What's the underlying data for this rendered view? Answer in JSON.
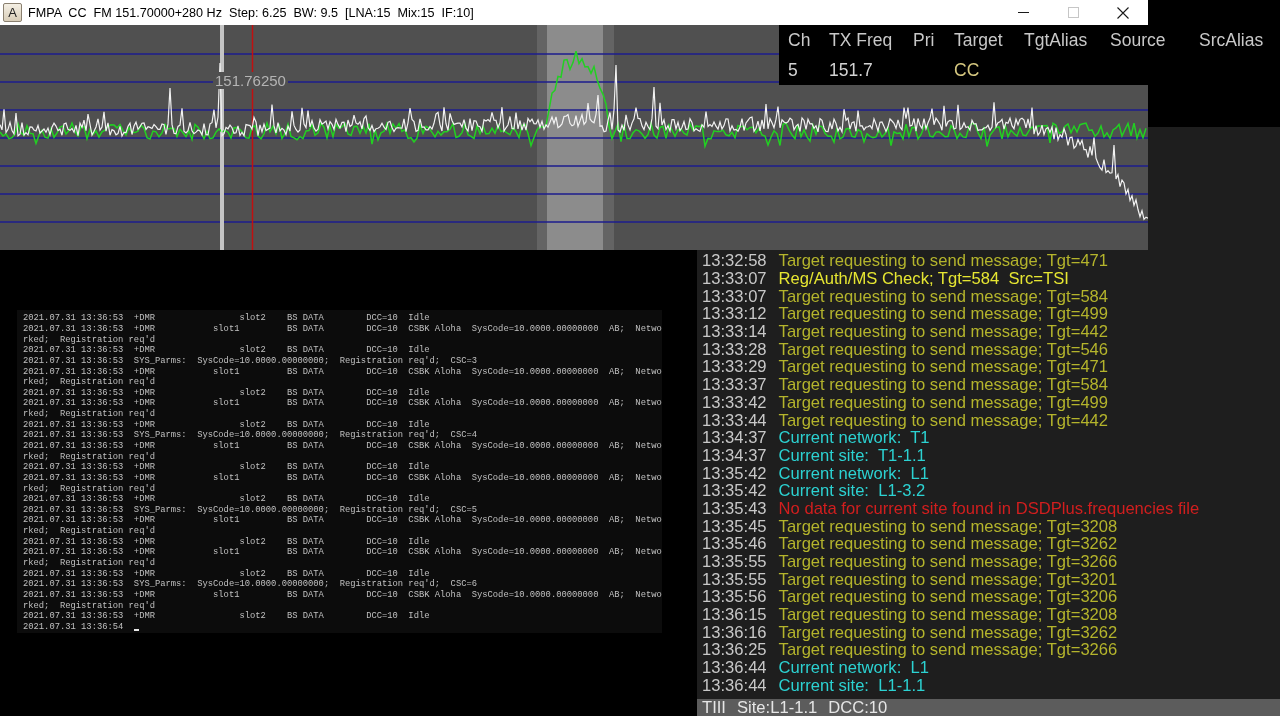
{
  "spectrum_window": {
    "app_icon": "A",
    "title": "FMPA  CC  FM 151.70000+280 Hz  Step: 6.25  BW: 9.5  [LNA:15  Mix:15  IF:10]",
    "window_controls": [
      {
        "kind": "minimize",
        "disabled": false
      },
      {
        "kind": "maximize",
        "disabled": true
      },
      {
        "kind": "close",
        "disabled": false
      }
    ],
    "frequency_label": "151.76250"
  },
  "channel_table": {
    "columns": [
      "Ch",
      "TX Freq",
      "Pri",
      "Target",
      "TgtAlias",
      "Source",
      "SrcAlias"
    ],
    "rows": [
      {
        "ch": "5",
        "tx_freq": "151.7",
        "target": "CC"
      }
    ]
  },
  "console": {
    "lines": [
      "2021.07.31 13:36:53  +DMR                slot2    BS DATA        DCC=10  Idle",
      "2021.07.31 13:36:53  +DMR           slot1         BS DATA        DCC=10  CSBK Aloha  SysCode=10.0000.00000000  AB;  Netwo",
      "rked;  Registration req'd",
      "2021.07.31 13:36:53  +DMR                slot2    BS DATA        DCC=10  Idle",
      "2021.07.31 13:36:53  SYS_Parms:  SysCode=10.0000.00000000;  Registration req'd;  CSC=3",
      "2021.07.31 13:36:53  +DMR           slot1         BS DATA        DCC=10  CSBK Aloha  SysCode=10.0000.00000000  AB;  Netwo",
      "rked;  Registration req'd",
      "2021.07.31 13:36:53  +DMR                slot2    BS DATA        DCC=10  Idle",
      "2021.07.31 13:36:53  +DMR           slot1         BS DATA        DCC=10  CSBK Aloha  SysCode=10.0000.00000000  AB;  Netwo",
      "rked;  Registration req'd",
      "2021.07.31 13:36:53  +DMR                slot2    BS DATA        DCC=10  Idle",
      "2021.07.31 13:36:53  SYS_Parms:  SysCode=10.0000.00000000;  Registration req'd;  CSC=4",
      "2021.07.31 13:36:53  +DMR           slot1         BS DATA        DCC=10  CSBK Aloha  SysCode=10.0000.00000000  AB;  Netwo",
      "rked;  Registration req'd",
      "2021.07.31 13:36:53  +DMR                slot2    BS DATA        DCC=10  Idle",
      "2021.07.31 13:36:53  +DMR           slot1         BS DATA        DCC=10  CSBK Aloha  SysCode=10.0000.00000000  AB;  Netwo",
      "rked;  Registration req'd",
      "2021.07.31 13:36:53  +DMR                slot2    BS DATA        DCC=10  Idle",
      "2021.07.31 13:36:53  SYS_Parms:  SysCode=10.0000.00000000;  Registration req'd;  CSC=5",
      "2021.07.31 13:36:53  +DMR           slot1         BS DATA        DCC=10  CSBK Aloha  SysCode=10.0000.00000000  AB;  Netwo",
      "rked;  Registration req'd",
      "2021.07.31 13:36:53  +DMR                slot2    BS DATA        DCC=10  Idle",
      "2021.07.31 13:36:53  +DMR           slot1         BS DATA        DCC=10  CSBK Aloha  SysCode=10.0000.00000000  AB;  Netwo",
      "rked;  Registration req'd",
      "2021.07.31 13:36:53  +DMR                slot2    BS DATA        DCC=10  Idle",
      "2021.07.31 13:36:53  SYS_Parms:  SysCode=10.0000.00000000;  Registration req'd;  CSC=6",
      "2021.07.31 13:36:53  +DMR           slot1         BS DATA        DCC=10  CSBK Aloha  SysCode=10.0000.00000000  AB;  Netwo",
      "rked;  Registration req'd",
      "2021.07.31 13:36:53  +DMR                slot2    BS DATA        DCC=10  Idle",
      "2021.07.31 13:36:54"
    ]
  },
  "event_log": {
    "entries": [
      {
        "time": "13:32:58",
        "text": "Target requesting to send message; Tgt=471",
        "color": "#b4b42c"
      },
      {
        "time": "13:33:07",
        "text": "Reg/Auth/MS Check; Tgt=584  Src=TSI",
        "color": "#e6e632"
      },
      {
        "time": "13:33:07",
        "text": "Target requesting to send message; Tgt=584",
        "color": "#b4b42c"
      },
      {
        "time": "13:33:12",
        "text": "Target requesting to send message; Tgt=499",
        "color": "#b4b42c"
      },
      {
        "time": "13:33:14",
        "text": "Target requesting to send message; Tgt=442",
        "color": "#b4b42c"
      },
      {
        "time": "13:33:28",
        "text": "Target requesting to send message; Tgt=546",
        "color": "#b4b42c"
      },
      {
        "time": "13:33:29",
        "text": "Target requesting to send message; Tgt=471",
        "color": "#b4b42c"
      },
      {
        "time": "13:33:37",
        "text": "Target requesting to send message; Tgt=584",
        "color": "#b4b42c"
      },
      {
        "time": "13:33:42",
        "text": "Target requesting to send message; Tgt=499",
        "color": "#b4b42c"
      },
      {
        "time": "13:33:44",
        "text": "Target requesting to send message; Tgt=442",
        "color": "#b4b42c"
      },
      {
        "time": "13:34:37",
        "text": "Current network:  T1",
        "color": "#2cd2d2"
      },
      {
        "time": "13:34:37",
        "text": "Current site:  T1-1.1",
        "color": "#2cd2d2"
      },
      {
        "time": "13:35:42",
        "text": "Current network:  L1",
        "color": "#2cd2d2"
      },
      {
        "time": "13:35:42",
        "text": "Current site:  L1-3.2",
        "color": "#2cd2d2"
      },
      {
        "time": "13:35:43",
        "text": "No data for current site found in DSDPlus.frequencies file",
        "color": "#d21e1e"
      },
      {
        "time": "13:35:45",
        "text": "Target requesting to send message; Tgt=3208",
        "color": "#b4b42c"
      },
      {
        "time": "13:35:46",
        "text": "Target requesting to send message; Tgt=3262",
        "color": "#b4b42c"
      },
      {
        "time": "13:35:55",
        "text": "Target requesting to send message; Tgt=3266",
        "color": "#b4b42c"
      },
      {
        "time": "13:35:55",
        "text": "Target requesting to send message; Tgt=3201",
        "color": "#b4b42c"
      },
      {
        "time": "13:35:56",
        "text": "Target requesting to send message; Tgt=3206",
        "color": "#b4b42c"
      },
      {
        "time": "13:36:15",
        "text": "Target requesting to send message; Tgt=3208",
        "color": "#b4b42c"
      },
      {
        "time": "13:36:16",
        "text": "Target requesting to send message; Tgt=3262",
        "color": "#b4b42c"
      },
      {
        "time": "13:36:25",
        "text": "Target requesting to send message; Tgt=3266",
        "color": "#b4b42c"
      },
      {
        "time": "13:36:44",
        "text": "Current network:  L1",
        "color": "#2cd2d2"
      },
      {
        "time": "13:36:44",
        "text": "Current site:  L1-1.1",
        "color": "#2cd2d2"
      }
    ],
    "status_bar": [
      "TIII",
      "Site:L1-1.1",
      "DCC:10"
    ]
  }
}
